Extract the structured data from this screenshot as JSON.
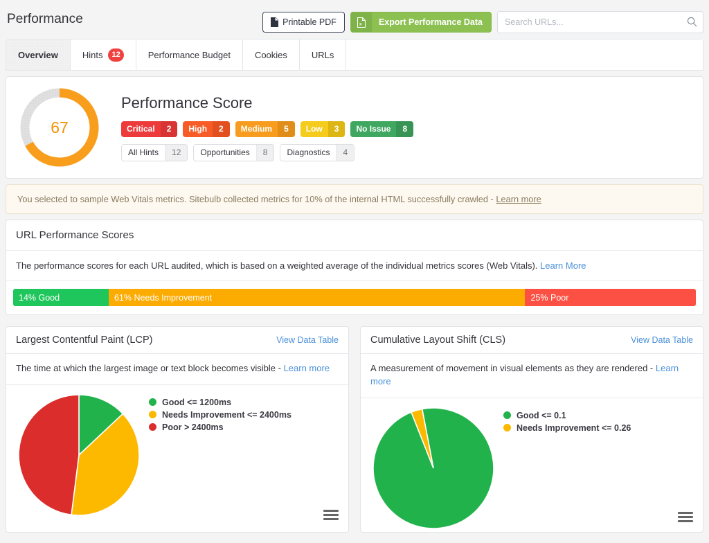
{
  "header": {
    "title": "Performance",
    "printable_pdf_label": "Printable PDF",
    "export_label": "Export Performance Data",
    "search_placeholder": "Search URLs..."
  },
  "tabs": [
    {
      "label": "Overview",
      "count": "",
      "active": true
    },
    {
      "label": "Hints",
      "count": "12",
      "active": false
    },
    {
      "label": "Performance Budget",
      "count": "",
      "active": false
    },
    {
      "label": "Cookies",
      "count": "",
      "active": false
    },
    {
      "label": "URLs",
      "count": "",
      "active": false
    }
  ],
  "score_card": {
    "title": "Performance Score",
    "score": "67",
    "score_pct": 67,
    "badges": [
      {
        "label": "Critical",
        "count": "2",
        "color": "#ed3b3b",
        "dark": "#d93434"
      },
      {
        "label": "High",
        "count": "2",
        "color": "#f75b26",
        "dark": "#e35020"
      },
      {
        "label": "Medium",
        "count": "5",
        "color": "#f79c1e",
        "dark": "#e08d19"
      },
      {
        "label": "Low",
        "count": "3",
        "color": "#f5cb1c",
        "dark": "#ddb614"
      },
      {
        "label": "No Issue",
        "count": "8",
        "color": "#3fa760",
        "dark": "#389455"
      }
    ],
    "filters": [
      {
        "label": "All Hints",
        "count": "12"
      },
      {
        "label": "Opportunities",
        "count": "8"
      },
      {
        "label": "Diagnostics",
        "count": "4"
      }
    ]
  },
  "notice": {
    "text": "You selected to sample Web Vitals metrics. Sitebulb collected metrics for 10% of the internal HTML successfully crawled - ",
    "link": "Learn more"
  },
  "url_performance": {
    "heading": "URL Performance Scores",
    "description": "The performance scores for each URL audited, which is based on a weighted average of the individual metrics scores (Web Vitals). ",
    "link": "Learn More"
  },
  "chart_data": [
    {
      "type": "bar",
      "name": "url-performance-scores-stacked-bar",
      "title": "URL Performance Scores",
      "orientation": "horizontal-stacked",
      "categories": [
        "Good",
        "Needs Improvement",
        "Poor"
      ],
      "values": [
        14,
        61,
        25
      ],
      "labels": [
        "14% Good",
        "61% Needs Improvement",
        "25% Poor"
      ],
      "colors": [
        "#1ec65c",
        "#fcab00",
        "#fb5043"
      ],
      "unit": "%",
      "xlabel": "",
      "ylabel": "",
      "xlim": [
        0,
        100
      ],
      "grid": false,
      "legend": "none"
    },
    {
      "type": "pie",
      "name": "lcp-pie",
      "title": "Largest Contentful Paint (LCP)",
      "description": "The time at which the largest image or text block becomes visible - ",
      "description_link": "Learn more",
      "view_data_table": "View Data Table",
      "labels": [
        "Good <= 1200ms",
        "Needs Improvement <= 2400ms",
        "Poor > 2400ms"
      ],
      "values": [
        13,
        39,
        48
      ],
      "colors": [
        "#22b24c",
        "#fcb900",
        "#dc2d2d"
      ],
      "legend": "right",
      "menu_icon": "hamburger-menu-icon"
    },
    {
      "type": "pie",
      "name": "cls-pie",
      "title": "Cumulative Layout Shift (CLS)",
      "description": "A measurement of movement in visual elements as they are rendered - ",
      "description_link": "Learn more",
      "view_data_table": "View Data Table",
      "labels": [
        "Good <= 0.1",
        "Needs Improvement <= 0.26"
      ],
      "values": [
        97,
        3
      ],
      "colors": [
        "#22b24c",
        "#fcb900"
      ],
      "legend": "right",
      "menu_icon": "hamburger-menu-icon"
    }
  ],
  "icons": {
    "pdf": "file-pdf-icon",
    "export": "file-excel-icon",
    "search": "search-icon",
    "menu": "hamburger-menu-icon"
  }
}
